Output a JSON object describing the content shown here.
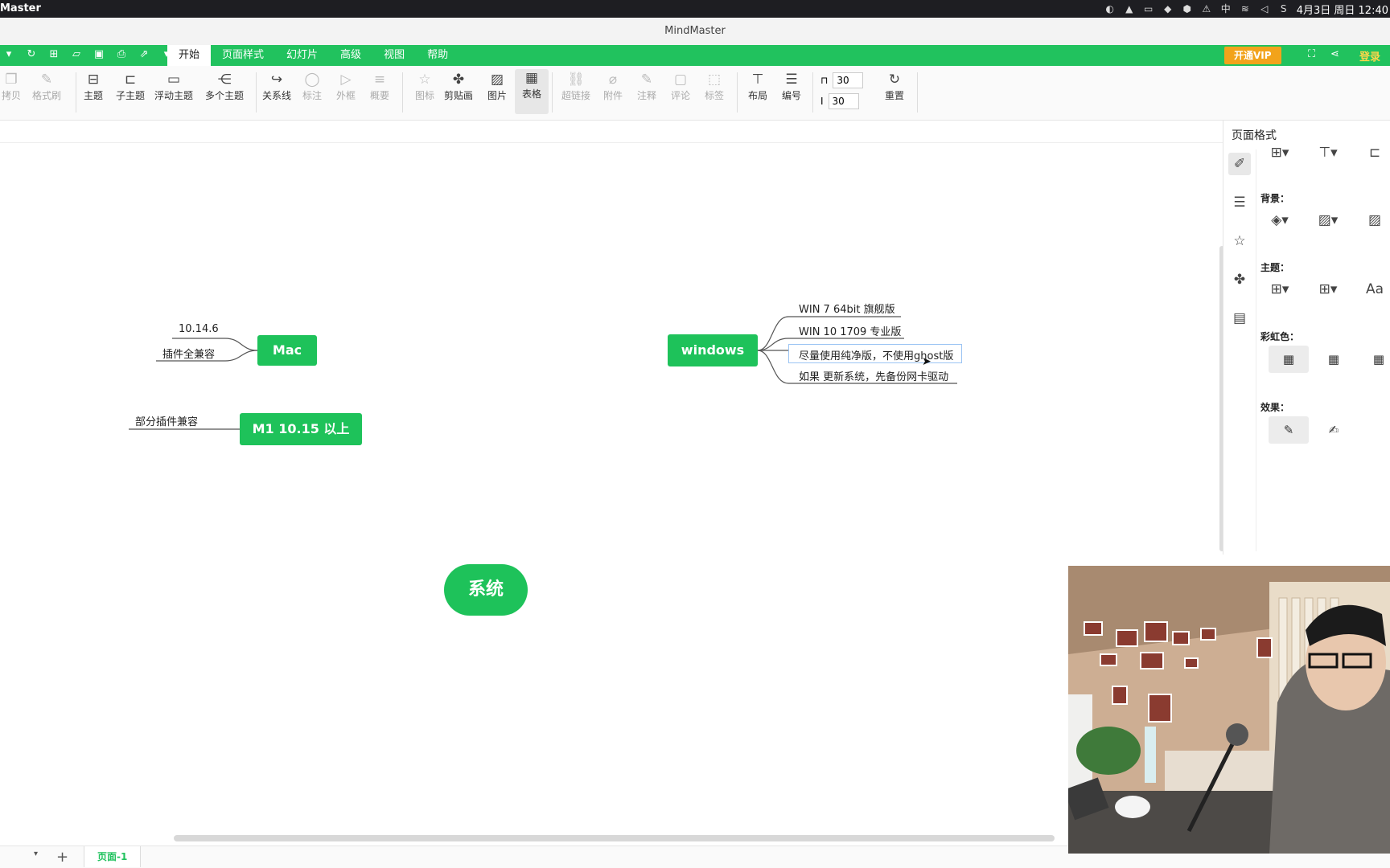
{
  "menubar": {
    "app_name": "Master",
    "datetime": "4月3日 周日 12:40"
  },
  "window": {
    "title": "MindMaster"
  },
  "tabs": [
    {
      "label": "开始",
      "active": true
    },
    {
      "label": "页面样式"
    },
    {
      "label": "幻灯片"
    },
    {
      "label": "高级"
    },
    {
      "label": "视图"
    },
    {
      "label": "帮助"
    }
  ],
  "header": {
    "vip_label": "开通VIP",
    "login_label": "登录"
  },
  "ribbon": {
    "copy": "拷贝",
    "format_brush": "格式刷",
    "topic": "主题",
    "subtopic": "子主题",
    "floating_topic": "浮动主题",
    "multi_topic": "多个主题",
    "relation": "关系线",
    "callout": "标注",
    "boundary": "外框",
    "summary": "概要",
    "icon": "图标",
    "clipart": "剪贴画",
    "image": "图片",
    "table": "表格",
    "hyperlink": "超链接",
    "attachment": "附件",
    "note": "注释",
    "comment": "评论",
    "tag": "标签",
    "layout": "布局",
    "numbering": "编号",
    "h_spacing": "30",
    "v_spacing": "30",
    "reset": "重置"
  },
  "mindmap": {
    "central": "系统",
    "mac": {
      "label": "Mac",
      "children": [
        "10.14.6",
        "插件全兼容"
      ]
    },
    "m1": {
      "label": "M1 10.15 以上",
      "children": [
        "部分插件兼容"
      ]
    },
    "windows": {
      "label": "windows",
      "children": [
        "WIN 7 64bit 旗舰版",
        "WIN 10 1709 专业版",
        "尽量使用纯净版，不使用ghost版",
        "如果 更新系统，先备份网卡驱动"
      ]
    }
  },
  "panel": {
    "title": "页面格式",
    "background_label": "背景：",
    "theme_label": "主题：",
    "rainbow_label": "彩虹色：",
    "effect_label": "效果："
  },
  "statusbar": {
    "page_tab": "页面-1"
  }
}
